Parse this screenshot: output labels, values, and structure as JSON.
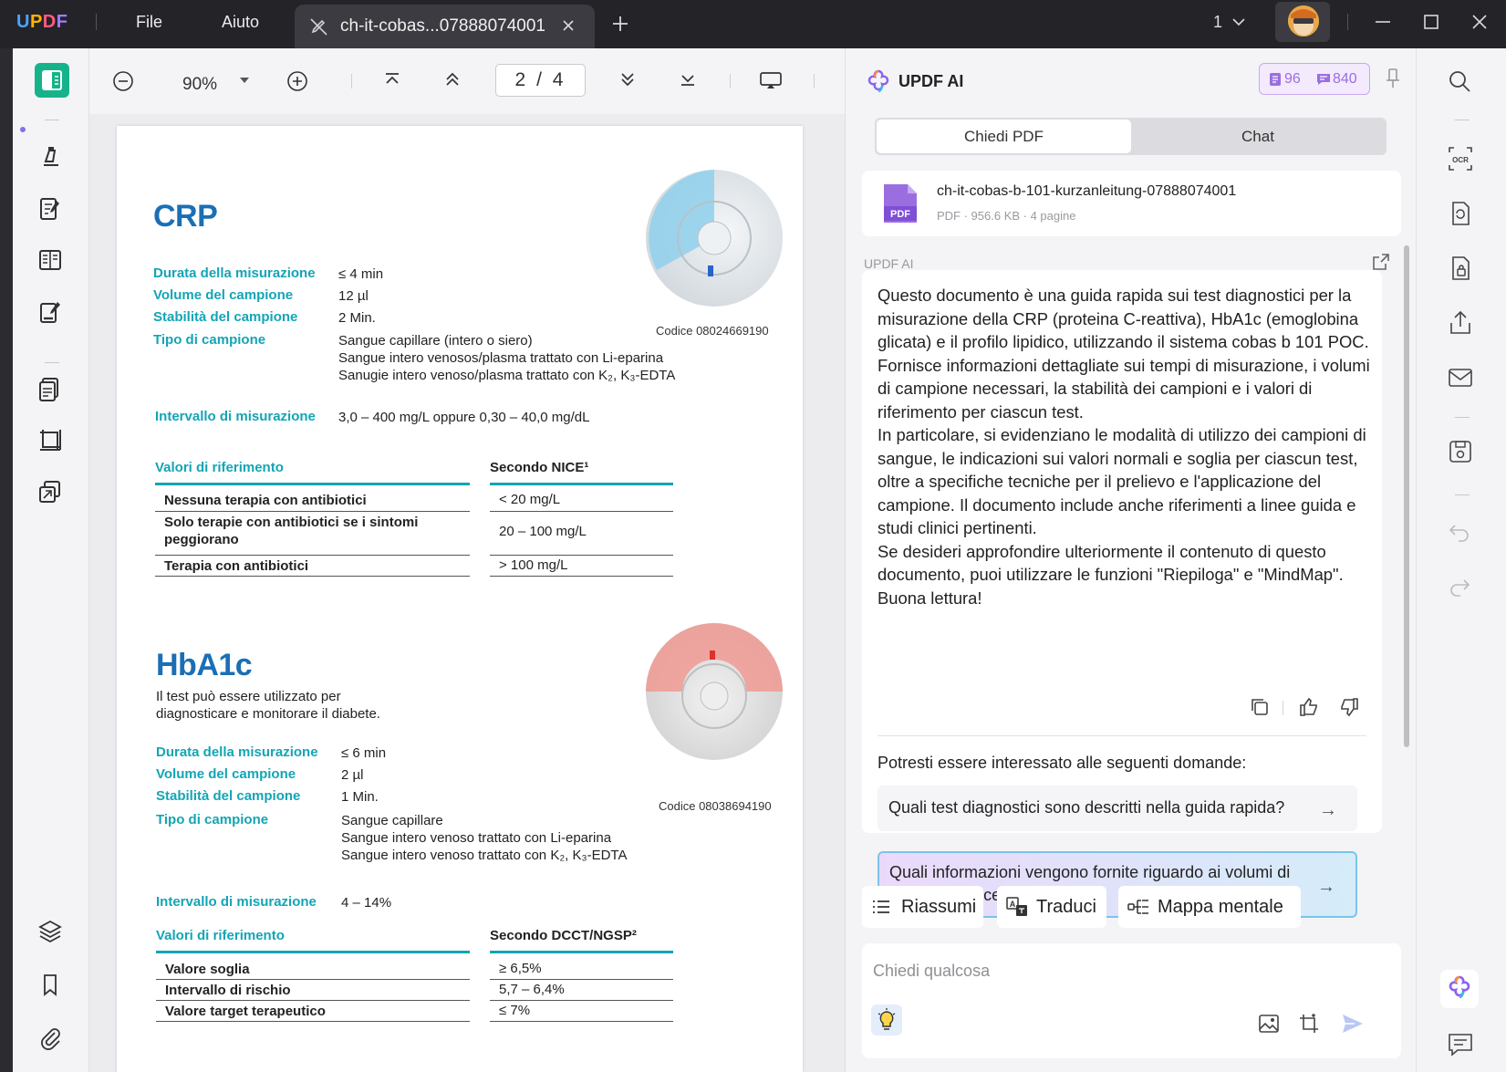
{
  "app": {
    "logo": "UPDF",
    "menu": [
      "File",
      "Aiuto"
    ],
    "tab_title": "ch-it-cobas...07888074001",
    "page_count_badge": "1"
  },
  "viewer": {
    "zoom": "90%",
    "current_page": "2",
    "total_pages": "4"
  },
  "document": {
    "crp": {
      "title": "CRP",
      "code": "Codice 08024669190",
      "fields": [
        {
          "label": "Durata della misurazione",
          "value": "≤ 4 min"
        },
        {
          "label": "Volume del campione",
          "value": "12 µl"
        },
        {
          "label": "Stabilità del campione",
          "value": "2 Min."
        },
        {
          "label": "Tipo di campione",
          "lines": [
            "Sangue capillare (intero o siero)",
            "Sangue intero venosos/plasma trattato con Li-eparina",
            "Sanugie intero venoso/plasma trattato con K₂, K₃-EDTA"
          ]
        },
        {
          "label": "Intervallo di misurazione",
          "value": "3,0 – 400 mg/L oppure 0,30 – 40,0 mg/dL"
        }
      ],
      "ref_header": "Valori di riferimento",
      "ref_source": "Secondo NICE¹",
      "rows": [
        {
          "label": "Nessuna terapia con antibiotici",
          "value": "< 20 mg/L"
        },
        {
          "label": "Solo terapie con antibiotici se i sintomi peggiorano",
          "value": "20 – 100 mg/L"
        },
        {
          "label": "Terapia con antibiotici",
          "value": "> 100 mg/L"
        }
      ]
    },
    "hba1c": {
      "title": "HbA1c",
      "intro": "Il test può essere utilizzato per diagnosticare e monitorare il diabete.",
      "code": "Codice 08038694190",
      "fields": [
        {
          "label": "Durata della misurazione",
          "value": "≤ 6 min"
        },
        {
          "label": "Volume del campione",
          "value": "2 µl"
        },
        {
          "label": "Stabilità del campione",
          "value": "1 Min."
        },
        {
          "label": "Tipo di campione",
          "lines": [
            "Sangue capillare",
            "Sangue intero venoso trattato con Li-eparina",
            "Sangue intero venoso trattato con K₂, K₃-EDTA"
          ]
        },
        {
          "label": "Intervallo di misurazione",
          "value": "4 – 14%"
        }
      ],
      "ref_header": "Valori di riferimento",
      "ref_source": "Secondo DCCT/NGSP²",
      "rows": [
        {
          "label": "Valore soglia",
          "value": "≥ 6,5%"
        },
        {
          "label": "Intervallo di rischio",
          "value": "5,7 – 6,4%"
        },
        {
          "label": "Valore target terapeutico",
          "value": "≤ 7%"
        }
      ]
    }
  },
  "ai": {
    "title": "UPDF AI",
    "credits_doc": "96",
    "credits_chat": "840",
    "tabs": [
      "Chiedi PDF",
      "Chat"
    ],
    "file_name": "ch-it-cobas-b-101-kurzanleitung-07888074001",
    "file_meta": "PDF · 956.6 KB · 4 pagine",
    "file_type": "PDF",
    "section_label": "UPDF AI",
    "answer": [
      "Questo documento è una guida rapida sui test diagnostici per la misurazione della CRP (proteina C-reattiva), HbA1c (emoglobina glicata) e il profilo lipidico, utilizzando il sistema cobas b 101 POC. Fornisce informazioni dettagliate sui tempi di misurazione, i volumi di campione necessari, la stabilità dei campioni e i valori di riferimento per ciascun test.",
      "In particolare, si evidenziano le modalità di utilizzo dei campioni di sangue, le indicazioni sui valori normali e soglia per ciascun test, oltre a specifiche tecniche per il prelievo e l'applicazione del campione. Il documento include anche riferimenti a linee guida e studi clinici pertinenti.",
      "Se desideri approfondire ulteriormente il contenuto di questo documento, puoi utilizzare le funzioni \"Riepiloga\" e \"MindMap\". Buona lettura!"
    ],
    "suggestions_label": "Potresti essere interessato alle seguenti domande:",
    "suggestions": [
      "Quali test diagnostici sono descritti nella guida rapida?",
      "Quali informazioni vengono fornite riguardo ai volumi di campione necessari?"
    ],
    "chips": [
      "Riassumi",
      "Traduci",
      "Mappa mentale"
    ],
    "input_placeholder": "Chiedi qualcosa"
  },
  "colors": {
    "accent_green": "#16b38a",
    "teal_label": "#13a5b5",
    "heading_blue": "#1a6fb5",
    "ai_purple": "#9b6ee0"
  }
}
